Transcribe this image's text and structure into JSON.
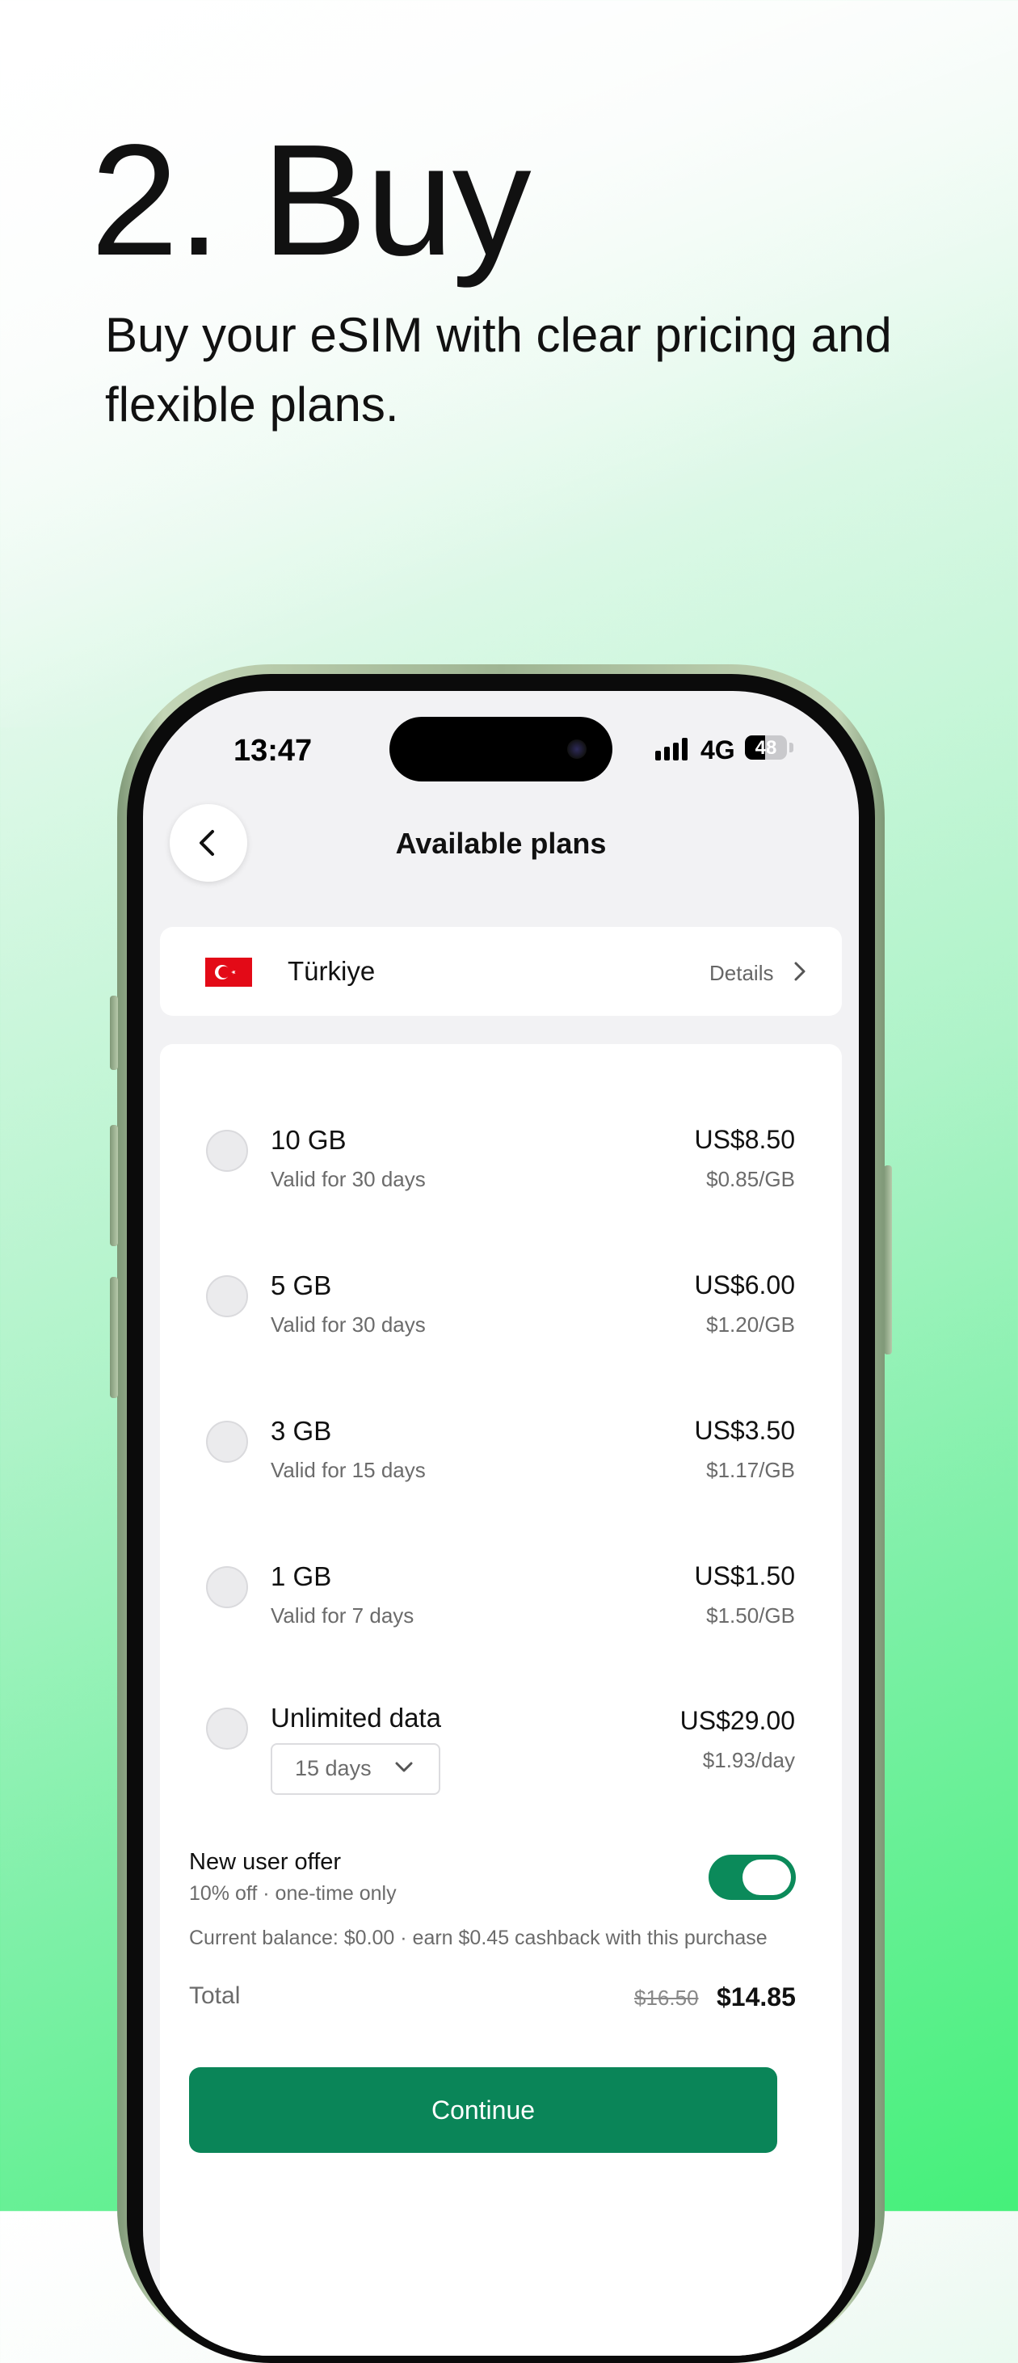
{
  "hero": {
    "heading": "2. Buy",
    "subheading": "Buy your eSIM with clear pricing and flexible plans."
  },
  "status_bar": {
    "time": "13:47",
    "network": "4G",
    "battery": "48",
    "battery_level": 0.48
  },
  "nav": {
    "title": "Available plans",
    "back_icon": "chevron-left-icon"
  },
  "country": {
    "name": "Türkiye",
    "details_label": "Details",
    "flag_icon": "turkey-flag-icon"
  },
  "plans": [
    {
      "name": "10 GB",
      "validity": "Valid for 30 days",
      "price": "US$8.50",
      "unit_price": "$0.85/GB"
    },
    {
      "name": "5 GB",
      "validity": "Valid for 30 days",
      "price": "US$6.00",
      "unit_price": "$1.20/GB"
    },
    {
      "name": "3 GB",
      "validity": "Valid for 15 days",
      "price": "US$3.50",
      "unit_price": "$1.17/GB"
    },
    {
      "name": "1 GB",
      "validity": "Valid for 7 days",
      "price": "US$1.50",
      "unit_price": "$1.50/GB"
    }
  ],
  "unlimited_plan": {
    "name": "Unlimited data",
    "duration": "15 days",
    "price": "US$29.00",
    "unit_price": "$1.93/day"
  },
  "offer": {
    "title": "New user offer",
    "subtitle": "10% off · one-time only",
    "enabled": true
  },
  "balance_note": "Current balance: $0.00 · earn $0.45 cashback with this purchase",
  "total": {
    "label": "Total",
    "original": "$16.50",
    "discounted": "$14.85"
  },
  "continue_label": "Continue",
  "colors": {
    "accent": "#0a8558",
    "toggle_on": "#0b8a5a",
    "flag_red": "#e30a17"
  }
}
